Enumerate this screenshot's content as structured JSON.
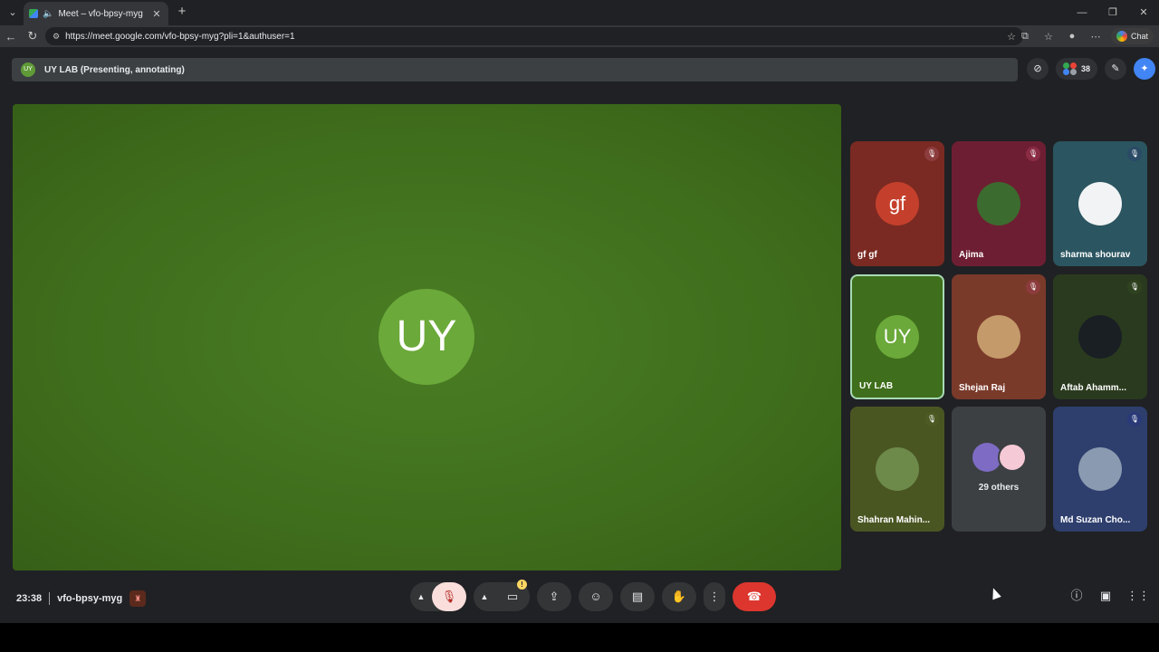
{
  "browser": {
    "tab_title": "Meet – vfo-bpsy-myg",
    "url": "https://meet.google.com/vfo-bpsy-myg?pli=1&authuser=1",
    "chat_label": "Chat"
  },
  "meet": {
    "presenter_initials": "UY",
    "presenter_bar_text": "UY LAB (Presenting, annotating)",
    "participant_count": "38",
    "main_avatar_initials": "UY",
    "tiles": [
      {
        "name": "gf gf",
        "initials": "gf",
        "bg": "#7a2a22",
        "avatar_color": "#c5402c",
        "mic_color": "#8c3c3c"
      },
      {
        "name": "Ajima",
        "initials": "",
        "bg": "#6e1e33",
        "avatar_color": "#3c6b2f",
        "mic_color": "#8a2c44"
      },
      {
        "name": "sharma shourav",
        "initials": "",
        "bg": "#2b5560",
        "avatar_color": "#f1f3f4",
        "mic_color": "#2a4a66"
      },
      {
        "name": "UY LAB",
        "initials": "UY",
        "bg": "#3f6e1c",
        "avatar_color": "#6ba93a",
        "mic_color": "#3f6e1c"
      },
      {
        "name": "Shejan Raj",
        "initials": "",
        "bg": "#7a3a2a",
        "avatar_color": "#c49a6a",
        "mic_color": "#8c3c3c"
      },
      {
        "name": "Aftab Ahamm...",
        "initials": "",
        "bg": "#2a3a1e",
        "avatar_color": "#1a1f24",
        "mic_color": "#2f4220"
      },
      {
        "name": "Shahran Mahin...",
        "initials": "",
        "bg": "#4a5622",
        "avatar_color": "#6d8a4a",
        "mic_color": "#4d5a24"
      },
      {
        "name": "Md Suzan Cho...",
        "initials": "",
        "bg": "#2e3f6e",
        "avatar_color": "#8a9ab0",
        "mic_color": "#2a3a78"
      }
    ],
    "others_label": "29 others",
    "clock": "23:38",
    "meeting_code": "vfo-bpsy-myg"
  }
}
